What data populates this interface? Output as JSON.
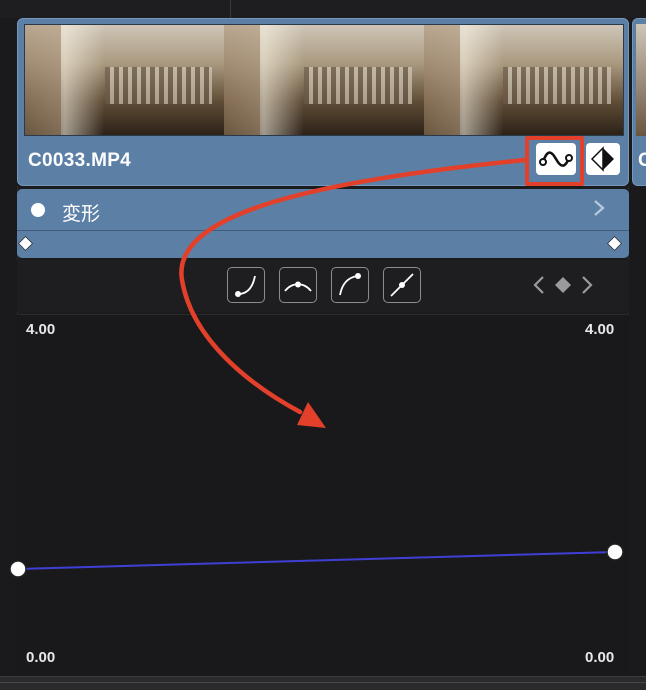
{
  "clip": {
    "name": "C0033.MP4",
    "next_clip_label": "C"
  },
  "transform": {
    "label": "変形"
  },
  "graph": {
    "top_left_value": "4.00",
    "top_right_value": "4.00",
    "bottom_left_value": "0.00",
    "bottom_right_value": "0.00"
  },
  "colors": {
    "clip": "#5c7fa6",
    "highlight": "#e2402a",
    "curve_line": "#3f3fd6",
    "graph_bg": "#19191b"
  },
  "icons": {
    "curve_editor": "curve-wave-icon",
    "keyframe": "keyframe-diamond-icon",
    "ease_in": "ease-in-curve-icon",
    "ease_in_out": "ease-in-out-curve-icon",
    "ease_out": "ease-out-curve-icon",
    "linear": "linear-curve-icon",
    "nav": "keyframe-nav-icon",
    "expand": "chevron-right-icon"
  }
}
